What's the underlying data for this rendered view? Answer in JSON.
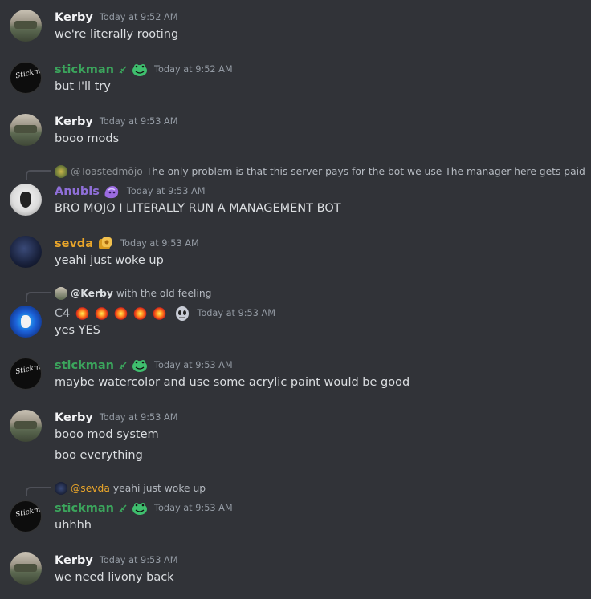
{
  "colors": {
    "background": "#313338",
    "kerby": "#f2f3f5",
    "stickman": "#3ba55c",
    "anubis": "#8f6fd8",
    "sevda": "#e9a52a",
    "c4": "#b5bac1",
    "timestamp": "#949ba4",
    "text": "#dbdee1"
  },
  "messages": [
    {
      "author": "Kerby",
      "timestamp": "Today at 9:52 AM",
      "lines": [
        "we're literally rooting"
      ]
    },
    {
      "author": "stickman",
      "badges": [
        "leaf-icon",
        "frog-icon"
      ],
      "timestamp": "Today at 9:52 AM",
      "lines": [
        "but I'll try"
      ]
    },
    {
      "author": "Kerby",
      "timestamp": "Today at 9:53 AM",
      "lines": [
        "booo mods"
      ]
    },
    {
      "reply": {
        "author": "@Toastedmōjo",
        "text": "The only problem is that this server pays for the bot we use The manager here gets paid"
      },
      "author": "Anubis",
      "badges": [
        "purple-blob-icon"
      ],
      "timestamp": "Today at 9:53 AM",
      "lines": [
        "BRO MOJO I LITERALLY RUN A MANAGEMENT BOT"
      ]
    },
    {
      "author": "sevda",
      "badges": [
        "gold-badge-icon"
      ],
      "timestamp": "Today at 9:53 AM",
      "lines": [
        "yeahi just woke up"
      ]
    },
    {
      "reply": {
        "author": "@Kerby",
        "text": "with the old feeling"
      },
      "author": "C4",
      "badges": [
        "collision-icon",
        "collision-icon",
        "collision-icon",
        "collision-icon",
        "collision-icon",
        "mask-icon"
      ],
      "timestamp": "Today at 9:53 AM",
      "lines": [
        "yes YES"
      ]
    },
    {
      "author": "stickman",
      "badges": [
        "leaf-icon",
        "frog-icon"
      ],
      "timestamp": "Today at 9:53 AM",
      "lines": [
        "maybe watercolor and use some acrylic paint would be good"
      ]
    },
    {
      "author": "Kerby",
      "timestamp": "Today at 9:53 AM",
      "lines": [
        "booo mod system",
        "boo everything"
      ]
    },
    {
      "reply": {
        "author": "@sevda",
        "text": "yeahi just woke up"
      },
      "author": "stickman",
      "badges": [
        "leaf-icon",
        "frog-icon"
      ],
      "timestamp": "Today at 9:53 AM",
      "lines": [
        "uhhhh"
      ]
    },
    {
      "author": "Kerby",
      "timestamp": "Today at 9:53 AM",
      "lines": [
        "we need livony back"
      ]
    }
  ],
  "avatar_labels": {
    "stickman": "Stickman"
  }
}
